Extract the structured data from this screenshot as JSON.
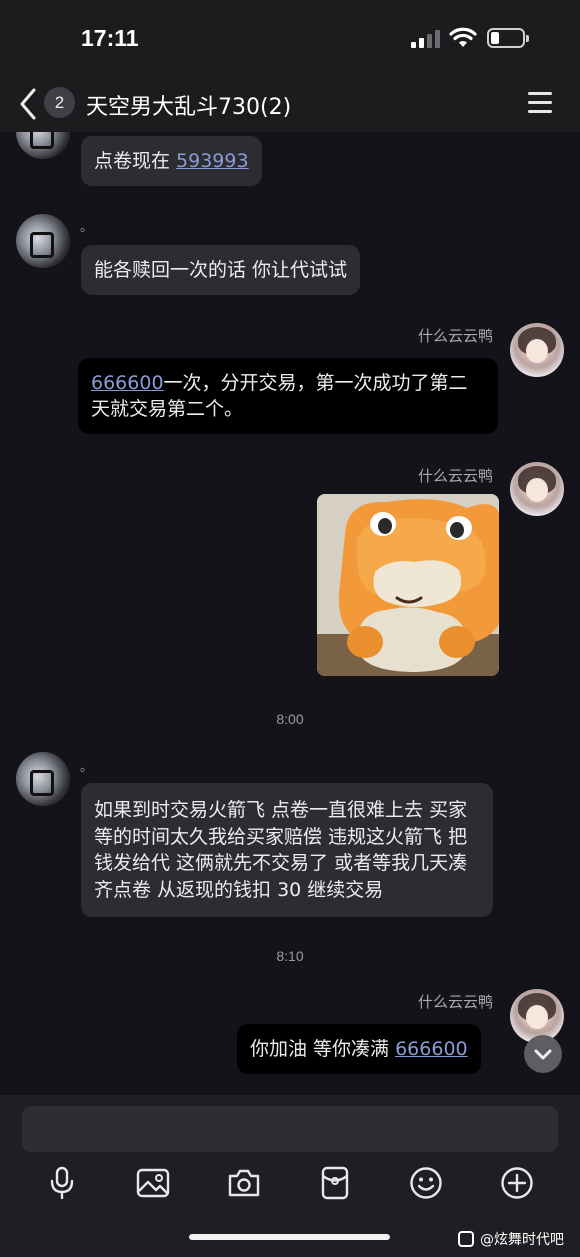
{
  "status_bar": {
    "time": "17:11"
  },
  "header": {
    "unread_count": "2",
    "title": "天空男大乱斗730(2)"
  },
  "messages": [
    {
      "side": "left",
      "text_prefix": "点卷现在 ",
      "link": "593993",
      "text_suffix": ""
    },
    {
      "side": "left",
      "sender": "。",
      "text": "能各赎回一次的话 你让代试试"
    },
    {
      "side": "right",
      "sender": "什么云云鸭",
      "link": "666600",
      "text_suffix": "一次，分开交易，第一次成功了第二天就交易第二个。"
    },
    {
      "side": "right",
      "sender": "什么云云鸭",
      "type": "sticker"
    },
    {
      "type": "time",
      "text": "8:00"
    },
    {
      "side": "left",
      "sender": "。",
      "text": "如果到时交易火箭飞 点卷一直很难上去 买家等的时间太久我给买家赔偿 违规这火箭飞 把钱发给代 这俩就先不交易了 或者等我几天凑齐点卷 从返现的钱扣 30 继续交易"
    },
    {
      "type": "time",
      "text": "8:10"
    },
    {
      "side": "right",
      "sender": "什么云云鸭",
      "text_prefix": "你加油 等你凑满 ",
      "link": "666600"
    }
  ],
  "input": {
    "placeholder": ""
  },
  "toolbar": {
    "icons": [
      "microphone-icon",
      "image-icon",
      "camera-icon",
      "red-packet-icon",
      "emoji-icon",
      "plus-icon"
    ]
  },
  "watermark": {
    "text": "@炫舞时代吧"
  },
  "colors": {
    "background": "#141319",
    "bubble_other": "#2c2c31",
    "bubble_mine": "#000000",
    "link": "#8b9bd8"
  }
}
